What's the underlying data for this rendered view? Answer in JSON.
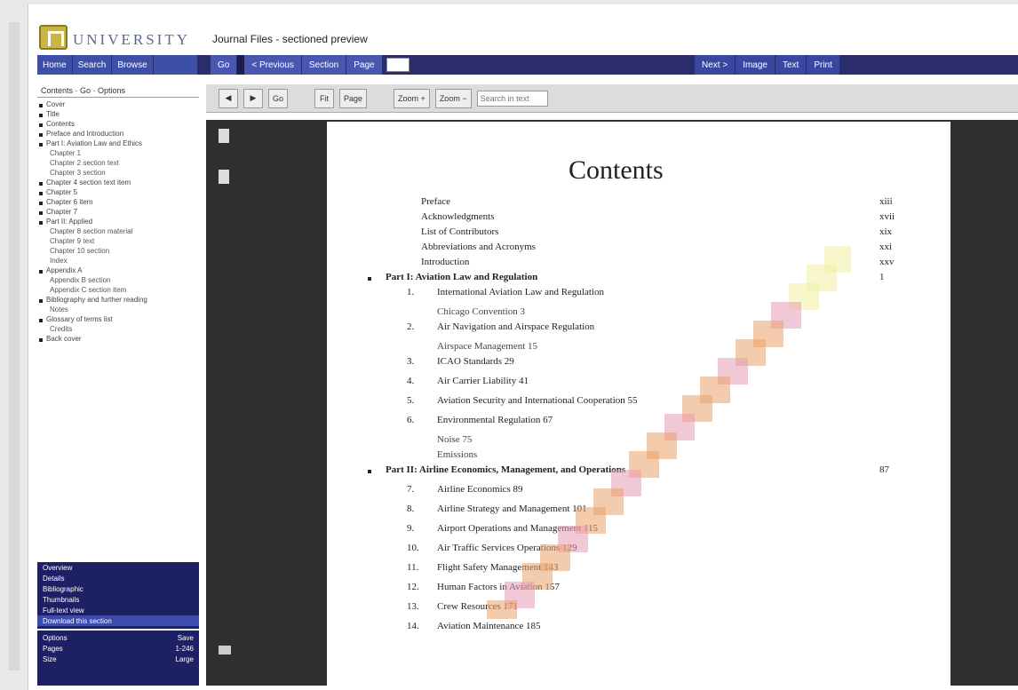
{
  "header": {
    "brand": "UNIVERSITY",
    "doc_title": "Journal Files - sectioned preview"
  },
  "nav": {
    "left_items": [
      "Home",
      "Search",
      "Browse"
    ],
    "mid_items": [
      "Go",
      "< Previous",
      "Section"
    ],
    "page_label": "Page",
    "right_items": [
      "Next >",
      "Image",
      "Text",
      "Print"
    ]
  },
  "sidebar": {
    "heading": "Contents · Go · Options",
    "items": [
      {
        "label": "Cover",
        "indent": false
      },
      {
        "label": "Title",
        "indent": false
      },
      {
        "label": "Contents",
        "indent": false
      },
      {
        "label": "Preface and Introduction",
        "indent": false
      },
      {
        "label": "Part I: Aviation Law and Ethics",
        "indent": false
      },
      {
        "label": "Chapter 1",
        "indent": true
      },
      {
        "label": "Chapter 2 section text",
        "indent": true
      },
      {
        "label": "Chapter 3 section",
        "indent": true
      },
      {
        "label": "Chapter 4 section text item",
        "indent": false
      },
      {
        "label": "Chapter 5",
        "indent": false
      },
      {
        "label": "Chapter 6 item",
        "indent": false
      },
      {
        "label": "Chapter 7",
        "indent": false
      },
      {
        "label": "Part II: Applied",
        "indent": false
      },
      {
        "label": "Chapter 8 section material",
        "indent": true
      },
      {
        "label": "Chapter 9 text",
        "indent": true
      },
      {
        "label": "Chapter 10 section",
        "indent": true
      },
      {
        "label": "Index",
        "indent": true
      },
      {
        "label": "Appendix A",
        "indent": false
      },
      {
        "label": "Appendix B section",
        "indent": true
      },
      {
        "label": "Appendix C section item",
        "indent": true
      },
      {
        "label": "Bibliography and further reading",
        "indent": false
      },
      {
        "label": "Notes",
        "indent": true
      },
      {
        "label": "Glossary of terms list",
        "indent": false
      },
      {
        "label": "Credits",
        "indent": true
      },
      {
        "label": "Back cover",
        "indent": false
      }
    ]
  },
  "bottom_panel": {
    "items": [
      "Overview",
      "Details",
      "Bibliographic",
      "Thumbnails",
      "Full-text view",
      "Download this section"
    ],
    "active_index": 5,
    "rows": [
      {
        "label": "Options",
        "value": "Save"
      },
      {
        "label": "Pages",
        "value": "1-246"
      },
      {
        "label": "Size",
        "value": "Large"
      }
    ]
  },
  "toolbar": {
    "buttons": [
      "◀",
      "▶",
      "Go",
      "Fit",
      "Page",
      "Zoom +",
      "Zoom −"
    ],
    "search_placeholder": "Search in text"
  },
  "page": {
    "title": "Contents",
    "front_matter": [
      {
        "label": "Preface",
        "page": "xiii"
      },
      {
        "label": "Acknowledgments",
        "page": "xvii"
      },
      {
        "label": "List of Contributors",
        "page": "xix"
      },
      {
        "label": "Abbreviations and Acronyms",
        "page": "xxi"
      },
      {
        "label": "Introduction",
        "page": "xxv"
      }
    ],
    "part1": {
      "label": "Part I: Aviation Law and Regulation",
      "page": "1"
    },
    "part1_chapters": [
      {
        "num": "1.",
        "label": "International Aviation Law and Regulation",
        "page": ""
      },
      {
        "num": "",
        "label": "Chicago Convention  3",
        "page": ""
      },
      {
        "num": "2.",
        "label": "Air Navigation and Airspace Regulation",
        "page": ""
      },
      {
        "num": "",
        "label": "Airspace Management  15",
        "page": ""
      },
      {
        "num": "3.",
        "label": "ICAO Standards  29",
        "page": ""
      },
      {
        "num": "4.",
        "label": "Air Carrier Liability  41",
        "page": ""
      },
      {
        "num": "5.",
        "label": "Aviation Security and International Cooperation  55",
        "page": ""
      },
      {
        "num": "6.",
        "label": "Environmental Regulation  67",
        "page": ""
      },
      {
        "num": "",
        "label": "Noise  75",
        "page": ""
      },
      {
        "num": "",
        "label": "Emissions",
        "page": ""
      }
    ],
    "part2": {
      "label": "Part II: Airline Economics, Management, and Operations",
      "page": "87"
    },
    "part2_chapters": [
      {
        "num": "7.",
        "label": "Airline Economics  89",
        "page": ""
      },
      {
        "num": "8.",
        "label": "Airline Strategy and Management  101",
        "page": ""
      },
      {
        "num": "9.",
        "label": "Airport Operations and Management  115",
        "page": ""
      },
      {
        "num": "10.",
        "label": "Air Traffic Services Operations  129",
        "page": ""
      },
      {
        "num": "11.",
        "label": "Flight Safety Management  143",
        "page": ""
      },
      {
        "num": "12.",
        "label": "Human Factors in Aviation  157",
        "page": ""
      },
      {
        "num": "13.",
        "label": "Crew Resources  171",
        "page": ""
      },
      {
        "num": "14.",
        "label": "Aviation Maintenance  185",
        "page": ""
      }
    ]
  },
  "colors": {
    "nav_dark": "#2b2d6a",
    "nav_accent": "#3d4fa6",
    "viewer_bg": "#2f2f2f",
    "diag_pink": "#e59ab2",
    "diag_orange": "#e9a26a",
    "diag_yellow": "#f3f0a0"
  }
}
